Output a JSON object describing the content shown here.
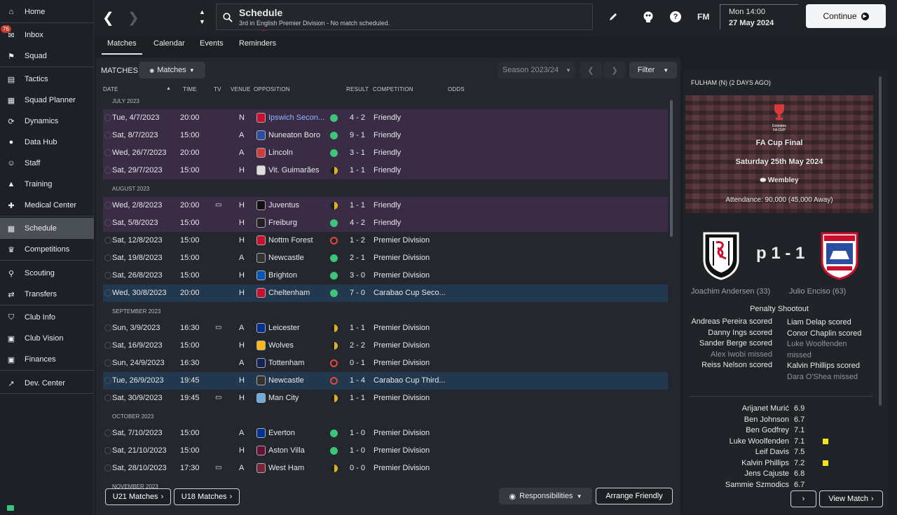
{
  "sidebar": {
    "items": [
      {
        "label": "Home",
        "icon": "home-icon"
      },
      {
        "label": "Inbox",
        "icon": "inbox-icon",
        "badge": "76"
      },
      {
        "label": "Squad",
        "icon": "squad-icon"
      },
      {
        "label": "Tactics",
        "icon": "tactics-icon"
      },
      {
        "label": "Squad Planner",
        "icon": "clipboard-icon"
      },
      {
        "label": "Dynamics",
        "icon": "dynamics-icon"
      },
      {
        "label": "Data Hub",
        "icon": "data-hub-icon"
      },
      {
        "label": "Staff",
        "icon": "staff-icon"
      },
      {
        "label": "Training",
        "icon": "training-icon"
      },
      {
        "label": "Medical Center",
        "icon": "medical-icon"
      },
      {
        "label": "Schedule",
        "icon": "calendar-icon"
      },
      {
        "label": "Competitions",
        "icon": "trophy-icon"
      },
      {
        "label": "Scouting",
        "icon": "search-icon"
      },
      {
        "label": "Transfers",
        "icon": "transfer-icon"
      },
      {
        "label": "Club Info",
        "icon": "shield-icon"
      },
      {
        "label": "Club Vision",
        "icon": "briefcase-icon"
      },
      {
        "label": "Finances",
        "icon": "wallet-icon"
      },
      {
        "label": "Dev. Center",
        "icon": "dev-center-icon"
      }
    ]
  },
  "header": {
    "title": "Schedule",
    "subtitle": "3rd in English Premier Division - No match scheduled.",
    "fm_label": "FM",
    "day_time": "Mon 14:00",
    "date": "27 May 2024",
    "continue_label": "Continue"
  },
  "tabs": [
    "Matches",
    "Calendar",
    "Events",
    "Reminders"
  ],
  "toolbar": {
    "section_label": "MATCHES",
    "view_dropdown": "Matches",
    "season": "Season 2023/24",
    "filter": "Filter"
  },
  "columns": {
    "date": "DATE",
    "time": "TIME",
    "tv": "TV",
    "venue": "VENUE",
    "opposition": "OPPOSITION",
    "result": "RESULT",
    "competition": "COMPETITION",
    "odds": "ODDS"
  },
  "months": [
    "JULY 2023",
    "AUGUST 2023",
    "SEPTEMBER 2023",
    "OCTOBER 2023",
    "NOVEMBER 2023"
  ],
  "matches": [
    {
      "date": "Tue, 4/7/2023",
      "time": "20:00",
      "tv": false,
      "venue": "N",
      "opp": "Ipswich Secon...",
      "outcome": "w",
      "score": "4 - 2",
      "comp": "Friendly",
      "color": "#c8102e"
    },
    {
      "date": "Sat, 8/7/2023",
      "time": "15:00",
      "tv": false,
      "venue": "A",
      "opp": "Nuneaton Boro",
      "outcome": "w",
      "score": "9 - 1",
      "comp": "Friendly",
      "color": "#2b4ea0"
    },
    {
      "date": "Wed, 26/7/2023",
      "time": "20:00",
      "tv": false,
      "venue": "A",
      "opp": "Lincoln",
      "outcome": "w",
      "score": "3 - 1",
      "comp": "Friendly",
      "color": "#d43a3a"
    },
    {
      "date": "Sat, 29/7/2023",
      "time": "15:00",
      "tv": false,
      "venue": "H",
      "opp": "Vit. Guimarães",
      "outcome": "d",
      "score": "1 - 1",
      "comp": "Friendly",
      "color": "#dddddd"
    },
    {
      "date": "Wed, 2/8/2023",
      "time": "20:00",
      "tv": true,
      "venue": "H",
      "opp": "Juventus",
      "outcome": "d",
      "score": "1 - 1",
      "comp": "Friendly",
      "color": "#111111"
    },
    {
      "date": "Sat, 5/8/2023",
      "time": "15:00",
      "tv": false,
      "venue": "H",
      "opp": "Freiburg",
      "outcome": "w",
      "score": "4 - 2",
      "comp": "Friendly",
      "color": "#222222"
    },
    {
      "date": "Sat, 12/8/2023",
      "time": "15:00",
      "tv": false,
      "venue": "H",
      "opp": "Nottm Forest",
      "outcome": "l",
      "score": "1 - 2",
      "comp": "Premier Division",
      "color": "#c8102e"
    },
    {
      "date": "Sat, 19/8/2023",
      "time": "15:00",
      "tv": false,
      "venue": "A",
      "opp": "Newcastle",
      "outcome": "w",
      "score": "2 - 1",
      "comp": "Premier Division",
      "color": "#333333"
    },
    {
      "date": "Sat, 26/8/2023",
      "time": "15:00",
      "tv": false,
      "venue": "H",
      "opp": "Brighton",
      "outcome": "w",
      "score": "3 - 0",
      "comp": "Premier Division",
      "color": "#0057b8"
    },
    {
      "date": "Wed, 30/8/2023",
      "time": "20:00",
      "tv": false,
      "venue": "H",
      "opp": "Cheltenham",
      "outcome": "w",
      "score": "7 - 0",
      "comp": "Carabao Cup Seco...",
      "color": "#c8102e"
    },
    {
      "date": "Sun, 3/9/2023",
      "time": "16:30",
      "tv": true,
      "venue": "A",
      "opp": "Leicester",
      "outcome": "d",
      "score": "1 - 1",
      "comp": "Premier Division",
      "color": "#003090"
    },
    {
      "date": "Sat, 16/9/2023",
      "time": "15:00",
      "tv": false,
      "venue": "H",
      "opp": "Wolves",
      "outcome": "d",
      "score": "2 - 2",
      "comp": "Premier Division",
      "color": "#fdb913"
    },
    {
      "date": "Sun, 24/9/2023",
      "time": "16:30",
      "tv": false,
      "venue": "A",
      "opp": "Tottenham",
      "outcome": "l",
      "score": "0 - 1",
      "comp": "Premier Division",
      "color": "#132257"
    },
    {
      "date": "Tue, 26/9/2023",
      "time": "19:45",
      "tv": false,
      "venue": "H",
      "opp": "Newcastle",
      "outcome": "l",
      "score": "1 - 4",
      "comp": "Carabao Cup Third...",
      "color": "#333333"
    },
    {
      "date": "Sat, 30/9/2023",
      "time": "19:45",
      "tv": true,
      "venue": "H",
      "opp": "Man City",
      "outcome": "d",
      "score": "1 - 1",
      "comp": "Premier Division",
      "color": "#6cabdd"
    },
    {
      "date": "Sat, 7/10/2023",
      "time": "15:00",
      "tv": false,
      "venue": "A",
      "opp": "Everton",
      "outcome": "w",
      "score": "1 - 0",
      "comp": "Premier Division",
      "color": "#003399"
    },
    {
      "date": "Sat, 21/10/2023",
      "time": "15:00",
      "tv": false,
      "venue": "H",
      "opp": "Aston Villa",
      "outcome": "w",
      "score": "1 - 0",
      "comp": "Premier Division",
      "color": "#670e36"
    },
    {
      "date": "Sat, 28/10/2023",
      "time": "17:30",
      "tv": true,
      "venue": "A",
      "opp": "West Ham",
      "outcome": "d",
      "score": "0 - 0",
      "comp": "Premier Division",
      "color": "#7a263a"
    }
  ],
  "footer": {
    "u21": "U21 Matches",
    "u18": "U18 Matches",
    "responsibilities": "Responsibilities",
    "arrange": "Arrange Friendly"
  },
  "match_panel": {
    "header": "FULHAM (N) (2 DAYS AGO)",
    "cup_logo_text": "Emirates FA CUP",
    "competition": "FA Cup Final",
    "date": "Saturday 25th May 2024",
    "venue": "Wembley",
    "attendance": "Attendance: 90,000 (45,000 Away)",
    "score": "p 1 - 1",
    "home_scorer": "Joachim Andersen (33)",
    "away_scorer": "Julio Enciso (63)",
    "shootout_title": "Penalty Shootout",
    "home_pens": [
      "Andreas Pereira scored",
      "Danny Ings scored",
      "Sander Berge scored",
      "Alex Iwobi missed",
      "Reiss Nelson scored"
    ],
    "away_pens": [
      "Liam Delap scored",
      "Conor Chaplin scored",
      "Luke Woolfenden missed",
      "Kalvin Phillips scored",
      "Dara O'Shea missed"
    ],
    "ratings": [
      {
        "name": "Arijanet Murić",
        "rating": "6.9",
        "card": false
      },
      {
        "name": "Ben Johnson",
        "rating": "6.7",
        "card": false
      },
      {
        "name": "Ben Godfrey",
        "rating": "7.1",
        "card": false
      },
      {
        "name": "Luke Woolfenden",
        "rating": "7.1",
        "card": true
      },
      {
        "name": "Leif Davis",
        "rating": "7.5",
        "card": false
      },
      {
        "name": "Kalvin Phillips",
        "rating": "7.2",
        "card": true
      },
      {
        "name": "Jens Cajuste",
        "rating": "6.8",
        "card": false
      },
      {
        "name": "Sammie Szmodics",
        "rating": "6.7",
        "card": false
      }
    ],
    "view_match": "View Match"
  },
  "colors": {
    "friendly_row": "#3a2c45",
    "highlight_row": "#22384e",
    "win": "#3ec47a",
    "draw": "#e3b021",
    "loss": "#e2493a",
    "link": "#8fb4ff"
  }
}
